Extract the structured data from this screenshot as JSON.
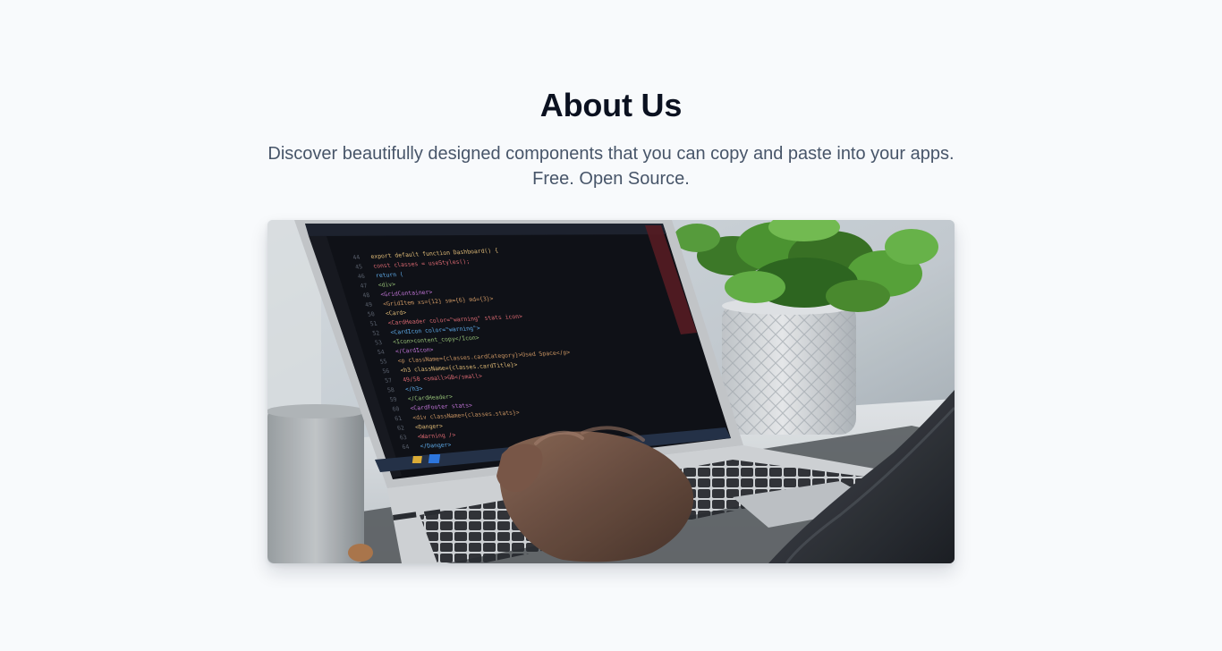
{
  "about": {
    "title": "About Us",
    "description_line_1": "Discover beautifully designed components that you can copy and paste into your apps.",
    "description_line_2": "Free. Open Source."
  },
  "hero_image": {
    "alt": "Person typing code on a laptop with a potted plant and a mug on the desk",
    "code_lines": [
      "export default function Dashboard() {",
      "  const classes = useStyles();",
      "  return (",
      "    <div>",
      "      <GridContainer>",
      "        <GridItem xs={12} sm={6} md={3}>",
      "          <Card>",
      "            <CardHeader color=\"warning\" stats icon>",
      "              <CardIcon color=\"warning\">",
      "                <Icon>content_copy</Icon>",
      "              </CardIcon>",
      "              <p className={classes.cardCategory}>Used Space</p>",
      "              <h3 className={classes.cardTitle}>",
      "                49/50 <small>GB</small>",
      "              </h3>",
      "            </CardHeader>",
      "            <CardFooter stats>",
      "              <div className={classes.stats}>",
      "                <Danger>",
      "                  <Warning />",
      "                </Danger>"
    ],
    "line_numbers": [
      "44",
      "45",
      "46",
      "47",
      "48",
      "49",
      "50",
      "51",
      "52",
      "53",
      "54",
      "55",
      "56",
      "57",
      "58",
      "59",
      "60",
      "61",
      "62",
      "63",
      "64"
    ]
  },
  "colors": {
    "background": "#f8fafc",
    "title": "#0b1120",
    "subtitle": "#475569"
  }
}
